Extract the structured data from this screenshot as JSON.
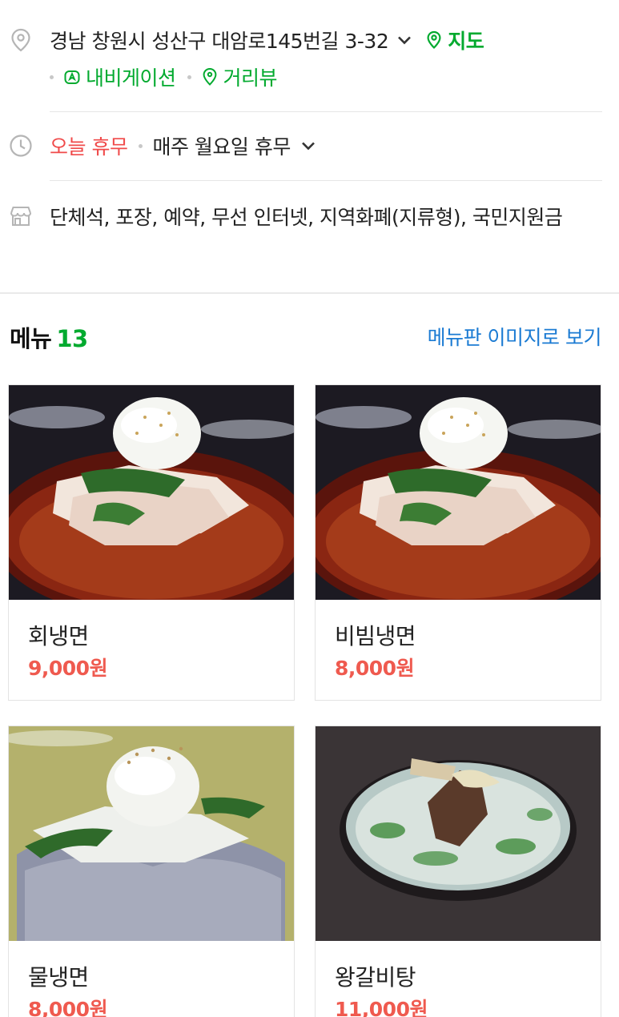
{
  "address": {
    "text": "경남 창원시 성산구 대암로145번길 3-32",
    "map_label": "지도",
    "navigation_label": "내비게이션",
    "street_view_label": "거리뷰"
  },
  "hours": {
    "status": "오늘 휴무",
    "regular_holiday": "매주 월요일 휴무"
  },
  "amenities": {
    "text": "단체석, 포장, 예약, 무선 인터넷, 지역화폐(지류형), 국민지원금"
  },
  "menu": {
    "title": "메뉴",
    "count": "13",
    "board_link": "메뉴판 이미지로 보기",
    "items": [
      {
        "name": "회냉면",
        "price": "9,000원"
      },
      {
        "name": "비빔냉면",
        "price": "8,000원"
      },
      {
        "name": "물냉면",
        "price": "8,000원"
      },
      {
        "name": "왕갈비탕",
        "price": "11,000원"
      }
    ]
  },
  "colors": {
    "green": "#03aa2f",
    "closed_red": "#f04a4a",
    "price_red": "#ef5a4f",
    "link_blue": "#1b7bd3"
  },
  "icons": [
    "location-pin-icon",
    "clock-icon",
    "store-icon",
    "chevron-down-icon",
    "map-pin-icon",
    "navigation-icon",
    "street-view-icon"
  ]
}
